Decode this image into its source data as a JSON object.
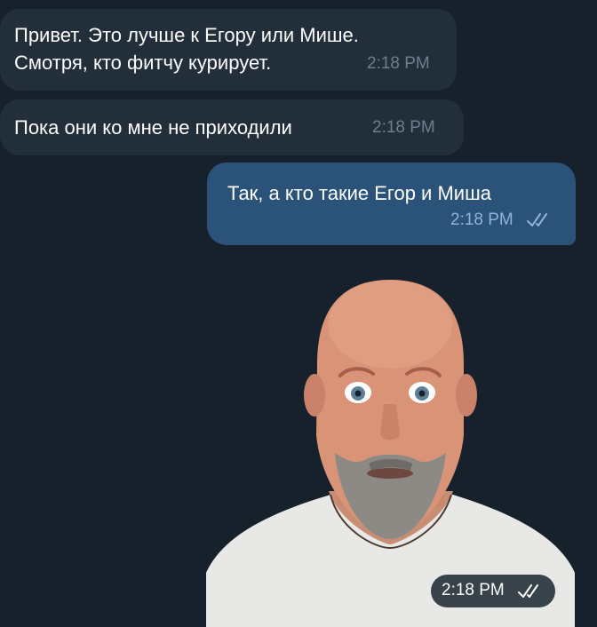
{
  "chat": {
    "messages": [
      {
        "direction": "incoming",
        "lines": [
          "Привет. Это лучше к Егору или Мише.",
          "Смотря, кто фитчу курирует."
        ],
        "time": "2:18 PM"
      },
      {
        "direction": "incoming",
        "lines": [
          "Пока они ко мне не приходили"
        ],
        "time": "2:18 PM"
      },
      {
        "direction": "outgoing",
        "lines": [
          "Так, а кто такие Егор и Миша"
        ],
        "time": "2:18 PM",
        "status_icon": "double-check-icon"
      },
      {
        "direction": "outgoing",
        "type": "sticker",
        "sticker_icon": "bald-bearded-man-sticker",
        "time": "2:18 PM",
        "status_icon": "double-check-icon"
      }
    ]
  },
  "colors": {
    "background": "#17212b",
    "incoming_bubble": "#222e3a",
    "outgoing_bubble": "#2b5278",
    "incoming_time": "#6d7f8f",
    "outgoing_time": "#8fb3d6"
  }
}
